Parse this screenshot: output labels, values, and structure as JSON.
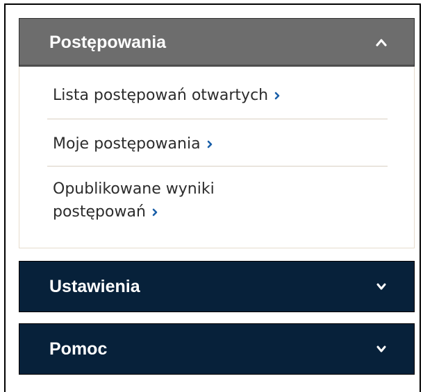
{
  "menu": {
    "postepowania": {
      "title": "Postępowania",
      "expanded": true,
      "items": [
        {
          "label": "Lista postępowań otwartych"
        },
        {
          "label": "Moje postępowania"
        },
        {
          "label_line1": "Opublikowane wyniki",
          "label_line2": "postępowań"
        }
      ]
    },
    "ustawienia": {
      "title": "Ustawienia",
      "expanded": false
    },
    "pomoc": {
      "title": "Pomoc",
      "expanded": false
    }
  },
  "colors": {
    "active_header": "#6d6d6d",
    "dark_header": "#07213a",
    "link_arrow": "#1a5fa8",
    "separator": "#d9cfc2"
  },
  "icons": {
    "expanded": "chevron-up-icon",
    "collapsed": "chevron-down-icon",
    "link": "chevron-right-icon"
  }
}
